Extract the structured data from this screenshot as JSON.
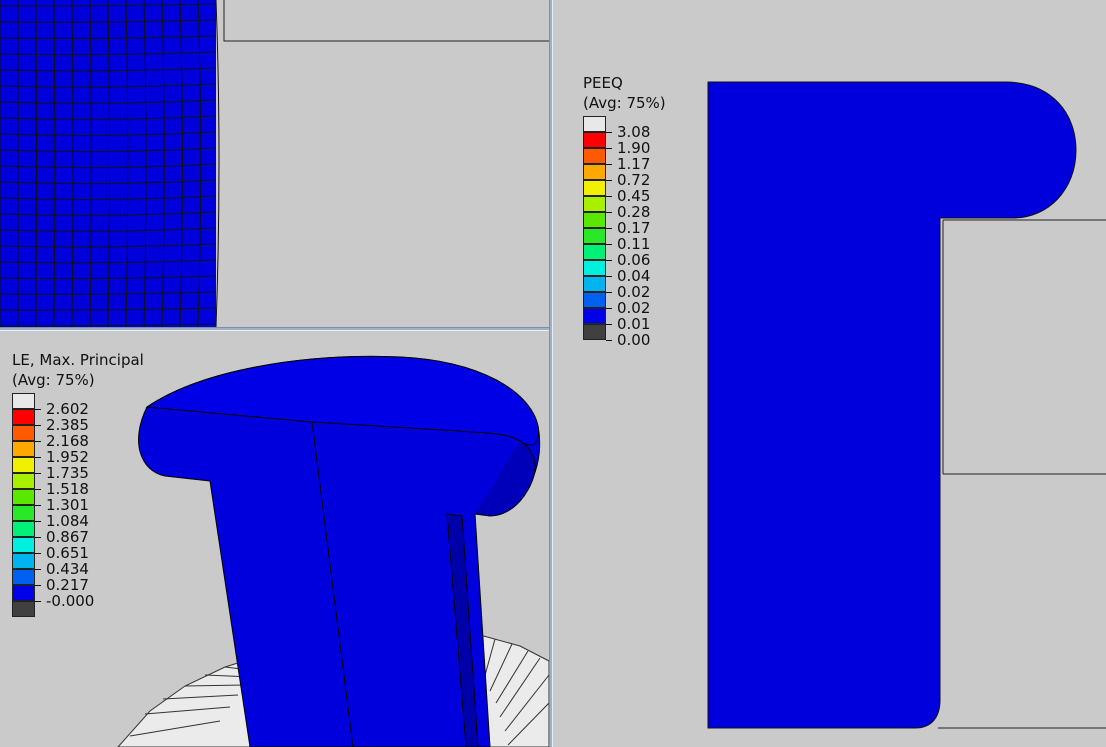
{
  "legend_le": {
    "title_line1": "LE, Max. Principal",
    "title_line2": "(Avg: 75%)",
    "values": [
      "2.602",
      "2.385",
      "2.168",
      "1.952",
      "1.735",
      "1.518",
      "1.301",
      "1.084",
      "0.867",
      "0.651",
      "0.434",
      "0.217",
      "-0.000"
    ],
    "colors": [
      "#e8e8e8",
      "#ff0000",
      "#ff5a00",
      "#ffa800",
      "#f0f000",
      "#a8f000",
      "#5ae800",
      "#28e828",
      "#00f078",
      "#00f0e0",
      "#00b4f0",
      "#0060f0",
      "#0000e8",
      "#404040"
    ]
  },
  "legend_peeq": {
    "title_line1": "PEEQ",
    "title_line2": "(Avg: 75%)",
    "values": [
      "3.08",
      "1.90",
      "1.17",
      "0.72",
      "0.45",
      "0.28",
      "0.17",
      "0.11",
      "0.06",
      "0.04",
      "0.02",
      "0.02",
      "0.01",
      "0.00"
    ],
    "colors": [
      "#e8e8e8",
      "#ff0000",
      "#ff5a00",
      "#ffa800",
      "#f0f000",
      "#a8f000",
      "#5ae800",
      "#28e828",
      "#00f078",
      "#00f0e0",
      "#00b4f0",
      "#0060f0",
      "#0000e8",
      "#404040"
    ]
  },
  "colors": {
    "background": "#cacaca",
    "part_blue": "#0000dd",
    "part_blue_dark": "#0000aa",
    "mesh_line": "#111111",
    "die_fill": "#eaeaea"
  }
}
